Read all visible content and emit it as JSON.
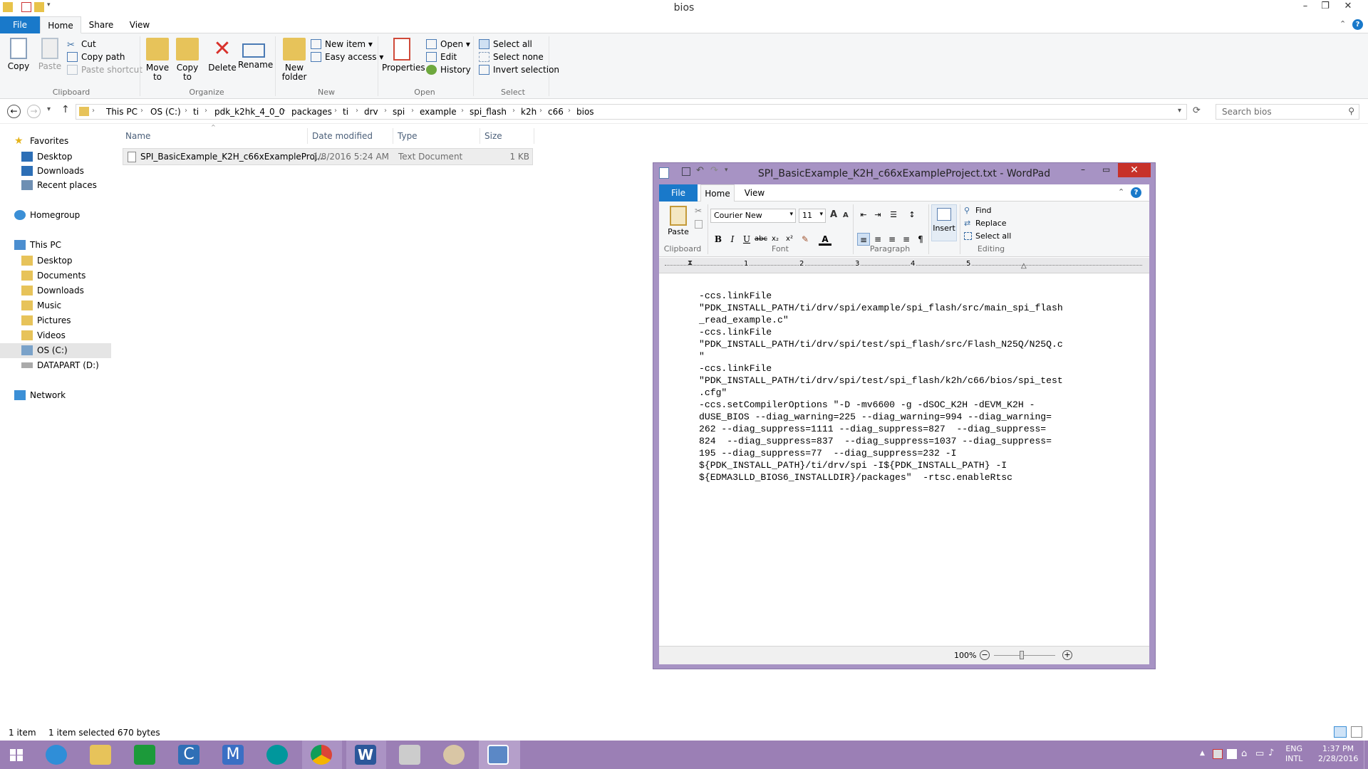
{
  "explorer": {
    "title": "bios",
    "tabs": [
      "File",
      "Home",
      "Share",
      "View"
    ],
    "ribbon": {
      "clipboard": {
        "copy": "Copy",
        "paste": "Paste",
        "cut": "Cut",
        "copy_path": "Copy path",
        "paste_shortcut": "Paste shortcut",
        "label": "Clipboard"
      },
      "organize": {
        "move_to_1": "Move",
        "move_to_2": "to",
        "copy_to_1": "Copy",
        "copy_to_2": "to",
        "delete": "Delete",
        "rename": "Rename",
        "label": "Organize"
      },
      "new": {
        "new_folder_1": "New",
        "new_folder_2": "folder",
        "new_item": "New item",
        "easy_access": "Easy access",
        "label": "New"
      },
      "open": {
        "properties": "Properties",
        "open": "Open",
        "edit": "Edit",
        "history": "History",
        "label": "Open"
      },
      "select": {
        "select_all": "Select all",
        "select_none": "Select none",
        "invert_selection": "Invert selection",
        "label": "Select"
      }
    },
    "address": {
      "crumbs": [
        "This PC",
        "OS (C:)",
        "ti",
        "pdk_k2hk_4_0_0",
        "packages",
        "ti",
        "drv",
        "spi",
        "example",
        "spi_flash",
        "k2h",
        "c66",
        "bios"
      ],
      "search_placeholder": "Search bios"
    },
    "nav": {
      "favorites": "Favorites",
      "fav_items": [
        "Desktop",
        "Downloads",
        "Recent places"
      ],
      "homegroup": "Homegroup",
      "this_pc": "This PC",
      "pc_items": [
        "Desktop",
        "Documents",
        "Downloads",
        "Music",
        "Pictures",
        "Videos",
        "OS (C:)",
        "DATAPART (D:)"
      ],
      "network": "Network"
    },
    "columns": {
      "name": "Name",
      "date": "Date modified",
      "type": "Type",
      "size": "Size"
    },
    "files": [
      {
        "name": "SPI_BasicExample_K2H_c66xExampleProj...",
        "date": "1/8/2016 5:24 AM",
        "type": "Text Document",
        "size": "1 KB"
      }
    ],
    "status": {
      "count": "1 item",
      "selected": "1 item selected  670 bytes"
    }
  },
  "wordpad": {
    "title": "SPI_BasicExample_K2H_c66xExampleProject.txt - WordPad",
    "tabs": [
      "File",
      "Home",
      "View"
    ],
    "clipboard": {
      "paste": "Paste",
      "label": "Clipboard"
    },
    "font": {
      "family": "Courier New",
      "size": "11",
      "label": "Font"
    },
    "paragraph_label": "Paragraph",
    "insert": "Insert",
    "editing": {
      "find": "Find",
      "replace": "Replace",
      "select_all": "Select all",
      "label": "Editing"
    },
    "ruler": [
      "1",
      "2",
      "3",
      "4",
      "5"
    ],
    "document_lines": [
      "-ccs.linkFile",
      "\"PDK_INSTALL_PATH/ti/drv/spi/example/spi_flash/src/main_spi_flash",
      "_read_example.c\"",
      "-ccs.linkFile",
      "\"PDK_INSTALL_PATH/ti/drv/spi/test/spi_flash/src/Flash_N25Q/N25Q.c",
      "\"",
      "-ccs.linkFile",
      "\"PDK_INSTALL_PATH/ti/drv/spi/test/spi_flash/k2h/c66/bios/spi_test",
      ".cfg\"",
      "-ccs.setCompilerOptions \"-D -mv6600 -g -dSOC_K2H -dEVM_K2H -",
      "dUSE_BIOS --diag_warning=225 --diag_warning=994 --diag_warning=",
      "262 --diag_suppress=1111 --diag_suppress=827  --diag_suppress=",
      "824  --diag_suppress=837  --diag_suppress=1037 --diag_suppress=",
      "195 --diag_suppress=77  --diag_suppress=232 -I",
      "${PDK_INSTALL_PATH}/ti/drv/spi -I${PDK_INSTALL_PATH} -I",
      "${EDMA3LLD_BIOS6_INSTALLDIR}/packages\"  -rtsc.enableRtsc"
    ],
    "zoom": "100%"
  },
  "tray": {
    "lang_1": "ENG",
    "lang_2": "INTL",
    "time": "1:37 PM",
    "date": "2/28/2016"
  },
  "colors": {
    "accent": "#1979ca",
    "taskbar": "#9b7fb5",
    "wordpad_frame": "#a793c4",
    "close": "#c7312a"
  }
}
